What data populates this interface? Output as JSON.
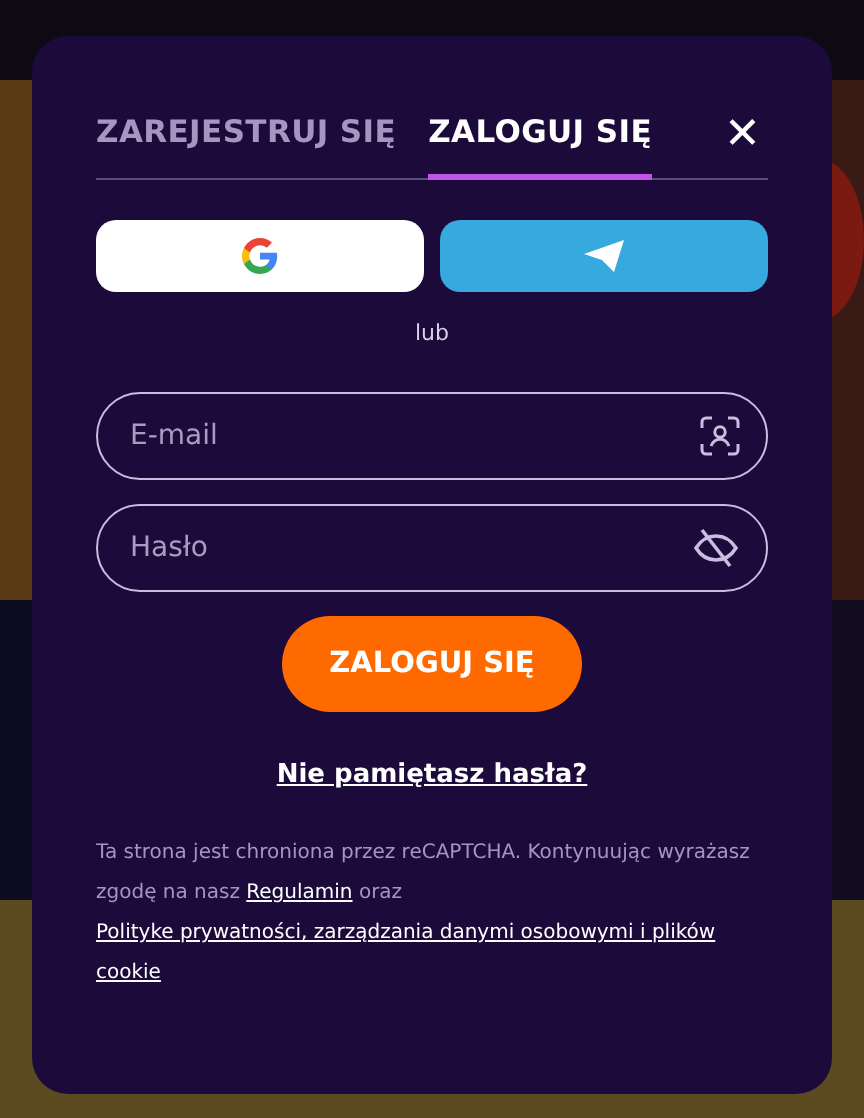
{
  "tabs": [
    {
      "label": "ZAREJESTRUJ SIĘ",
      "selected": false
    },
    {
      "label": "ZALOGUJ SIĘ",
      "selected": true
    }
  ],
  "close": "✕",
  "divider_text": "lub",
  "fields": [
    {
      "placeholder": "E-mail",
      "kind": "email"
    },
    {
      "placeholder": "Hasło",
      "kind": "password"
    }
  ],
  "submit": "ZALOGUJ SIĘ",
  "forgot_link": "Nie pamiętasz hasła?",
  "legal": {
    "text": "Ta strona jest chroniona przez reCAPTCHA. Kontynuując wyrażasz zgodę na nasz",
    "terms_link": "Regulamin",
    "conjunction": "oraz",
    "privacy_link": "Polityke prywatności, zarządzania danymi osobowymi i plików cookie"
  }
}
